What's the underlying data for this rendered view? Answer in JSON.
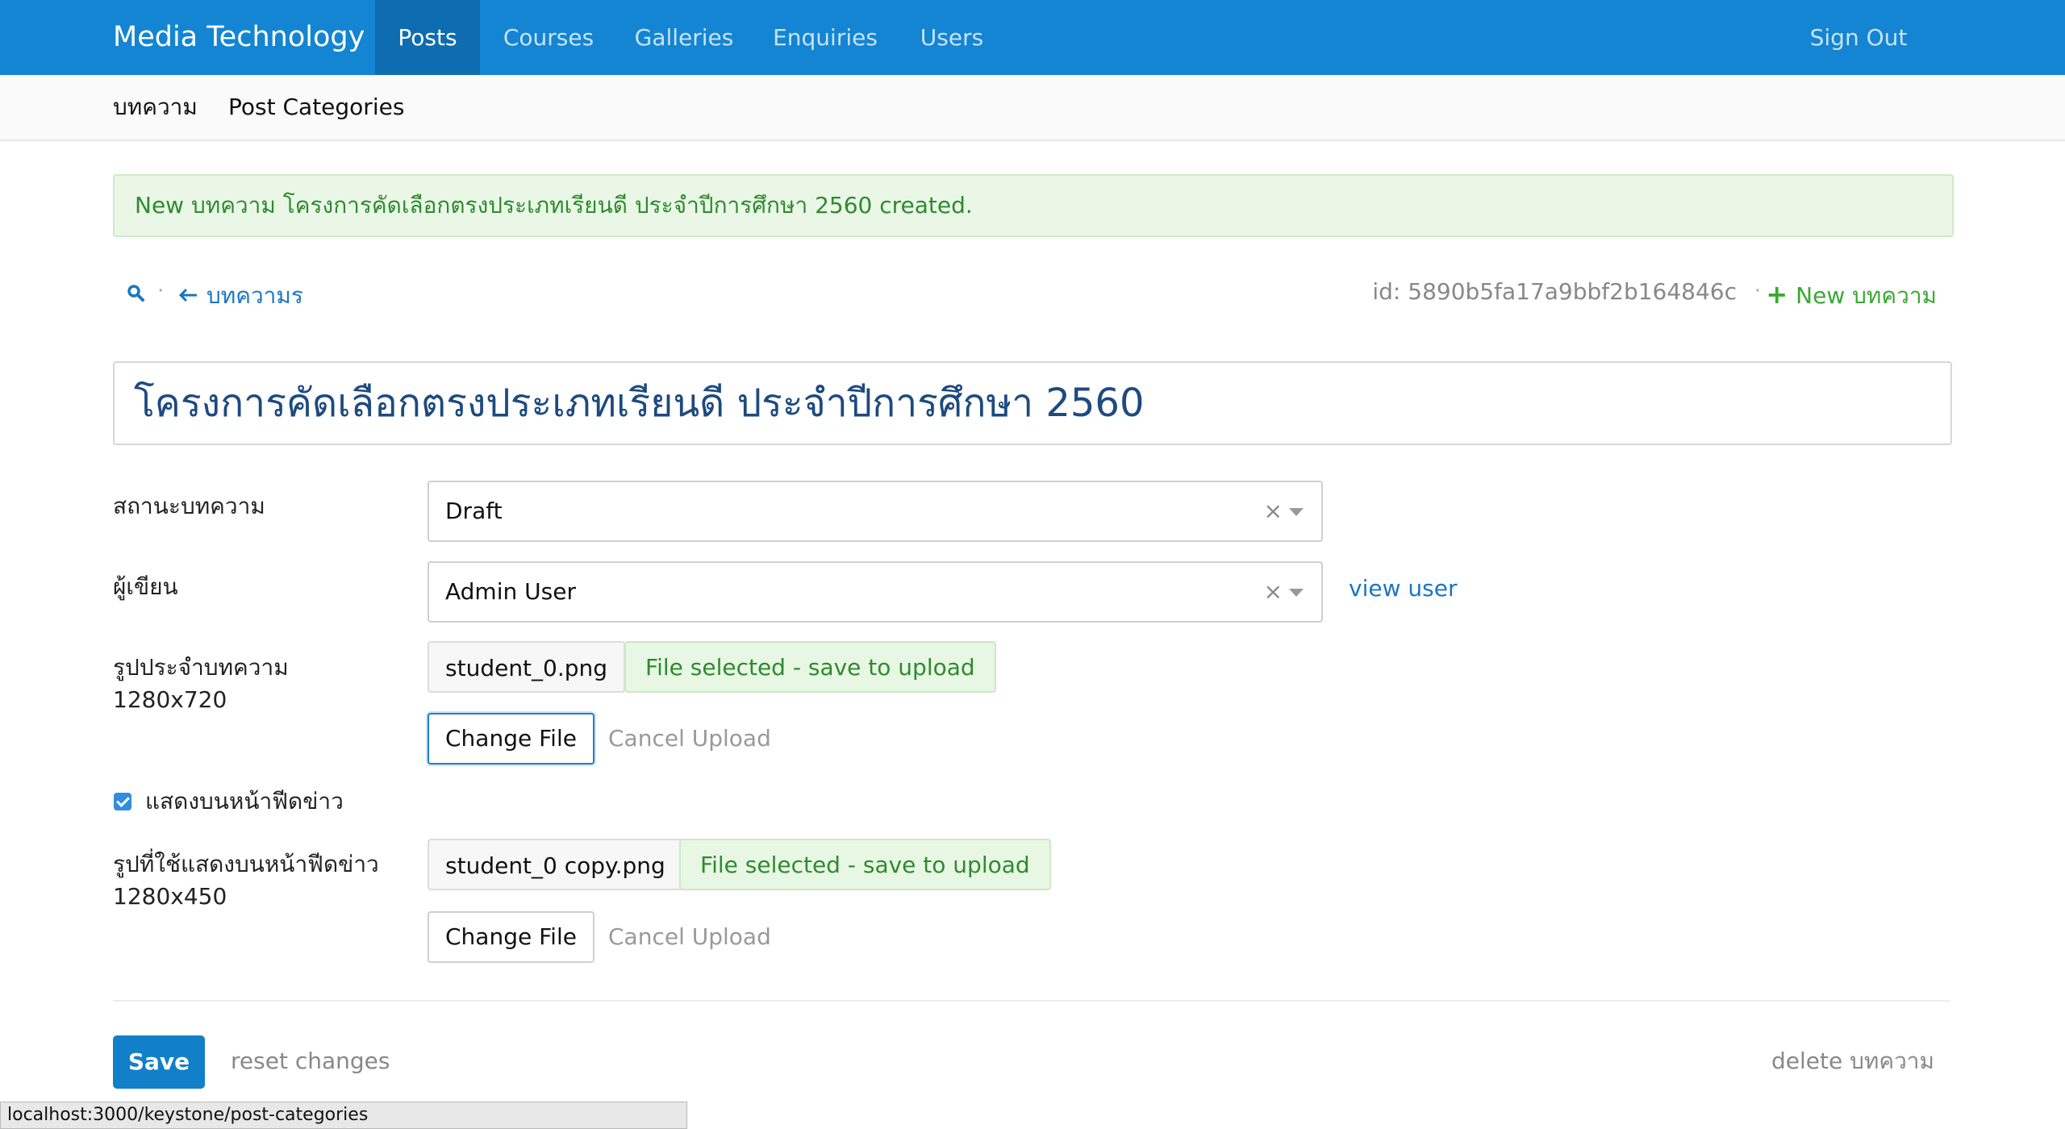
{
  "nav": {
    "brand": "Media Technology",
    "items": [
      {
        "label": "Posts"
      },
      {
        "label": "Courses"
      },
      {
        "label": "Galleries"
      },
      {
        "label": "Enquiries"
      },
      {
        "label": "Users"
      }
    ],
    "sign_out": "Sign Out"
  },
  "subnav": {
    "items": [
      {
        "label": "บทความ"
      },
      {
        "label": "Post Categories"
      }
    ]
  },
  "alert": {
    "message": "New บทความ โครงการคัดเลือกตรงประเภทเรียนดี ประจำปีการศึกษา 2560 created."
  },
  "toolbar": {
    "dot": "·",
    "back_label": "บทความร",
    "id_text": "id: 5890b5fa17a9bbf2b164846c",
    "new_label": "New บทความ"
  },
  "title": "โครงการคัดเลือกตรงประเภทเรียนดี ประจำปีการศึกษา 2560",
  "fields": {
    "status": {
      "label": "สถานะบทความ",
      "value": "Draft"
    },
    "author": {
      "label": "ผู้เขียน",
      "value": "Admin User",
      "link": "view user"
    },
    "image": {
      "label": "รูปประจำบทความ",
      "size": "1280x720",
      "file": "student_0.png",
      "badge": "File selected - save to upload",
      "change": "Change File",
      "cancel": "Cancel Upload"
    },
    "show_feed": {
      "label": "แสดงบนหน้าฟีดข่าว",
      "checked": true
    },
    "feed_image": {
      "label": "รูปที่ใช้แสดงบนหน้าฟีดข่าว",
      "size": "1280x450",
      "file": "student_0 copy.png",
      "badge": "File selected - save to upload",
      "change": "Change File",
      "cancel": "Cancel Upload"
    },
    "clear_symbol": "×"
  },
  "footer": {
    "save": "Save",
    "reset": "reset changes",
    "delete": "delete บทความ"
  },
  "statusbar": "localhost:3000/keystone/post-categories",
  "colors": {
    "nav_bg": "#1385d2",
    "nav_active": "#0e6db1",
    "success": "#2f8a2f",
    "link": "#1a76c4"
  }
}
